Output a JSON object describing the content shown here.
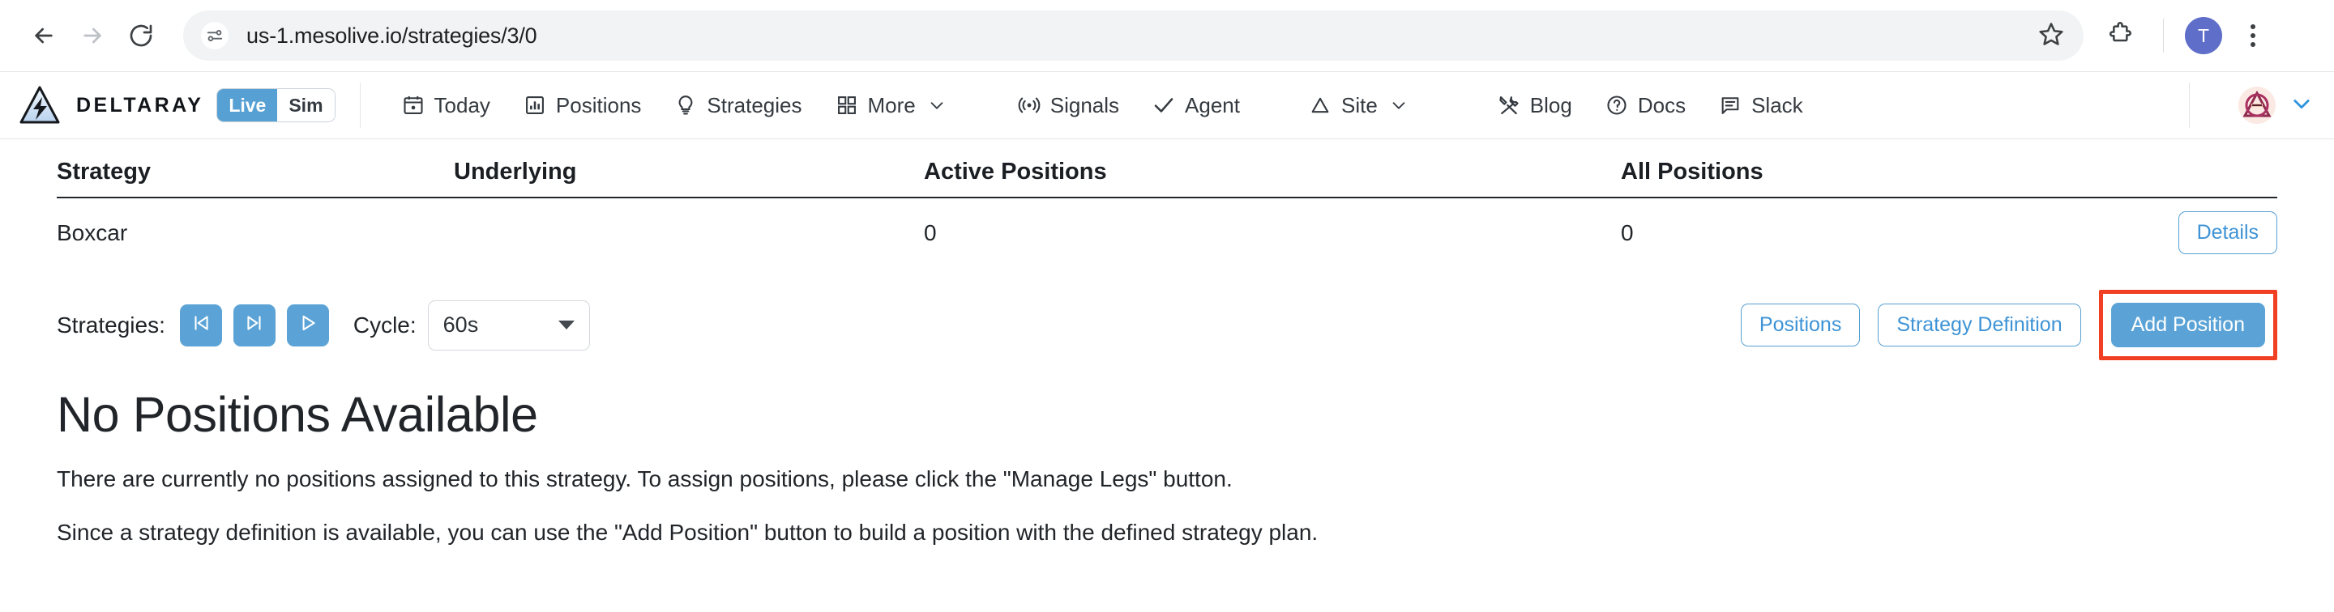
{
  "browser": {
    "url": "us-1.mesolive.io/strategies/3/0",
    "back_icon": "back-arrow-icon",
    "forward_icon": "forward-arrow-icon",
    "reload_icon": "reload-icon",
    "site_info_icon": "site-settings-icon",
    "bookmark_icon": "star-icon",
    "extensions_icon": "puzzle-piece-icon",
    "profile_initial": "T",
    "menu_icon": "three-dot-menu-icon"
  },
  "app": {
    "brand_name": "DELTARAY",
    "logo_icon": "deltaray-triangle-bolt-logo",
    "mode": {
      "live_label": "Live",
      "sim_label": "Sim",
      "active": "Live"
    },
    "nav": [
      {
        "label": "Today",
        "icon": "calendar-icon"
      },
      {
        "label": "Positions",
        "icon": "bar-chart-icon"
      },
      {
        "label": "Strategies",
        "icon": "lightbulb-icon"
      },
      {
        "label": "More",
        "icon": "grid-icon",
        "chevron": "chevron-down-icon"
      },
      {
        "label": "Signals",
        "icon": "broadcast-icon"
      },
      {
        "label": "Agent",
        "icon": "check-icon"
      },
      {
        "label": "Site",
        "icon": "triangle-icon",
        "chevron": "chevron-down-icon"
      },
      {
        "label": "Blog",
        "icon": "tools-icon"
      },
      {
        "label": "Docs",
        "icon": "question-circle-icon"
      },
      {
        "label": "Slack",
        "icon": "chat-bubble-icon"
      }
    ],
    "user": {
      "avatar_icon": "user-avatar",
      "chevron": "chevron-down-icon"
    }
  },
  "table": {
    "columns": [
      "Strategy",
      "Underlying",
      "Active Positions",
      "All Positions"
    ],
    "rows": [
      {
        "strategy": "Boxcar",
        "underlying": "",
        "active_positions": "0",
        "all_positions": "0",
        "action_label": "Details"
      }
    ]
  },
  "controls": {
    "strategies_label": "Strategies:",
    "first_icon": "skip-to-start-icon",
    "next_icon": "skip-to-next-icon",
    "play_icon": "play-icon",
    "cycle_label": "Cycle:",
    "cycle_value": "60s",
    "cycle_options": [
      "60s"
    ],
    "positions_label": "Positions",
    "strategy_definition_label": "Strategy Definition",
    "add_position_label": "Add Position"
  },
  "main": {
    "title": "No Positions Available",
    "paragraph_1": "There are currently no positions assigned to this strategy. To assign positions, please click the \"Manage Legs\" button.",
    "paragraph_2": "Since a strategy definition is available, you can use the \"Add Position\" button to build a position with the defined strategy plan."
  },
  "colors": {
    "accent_blue": "#5ba3d6",
    "link_blue": "#3d93d6",
    "highlight_red": "#f03f22",
    "profile_purple": "#5f6ec8"
  }
}
